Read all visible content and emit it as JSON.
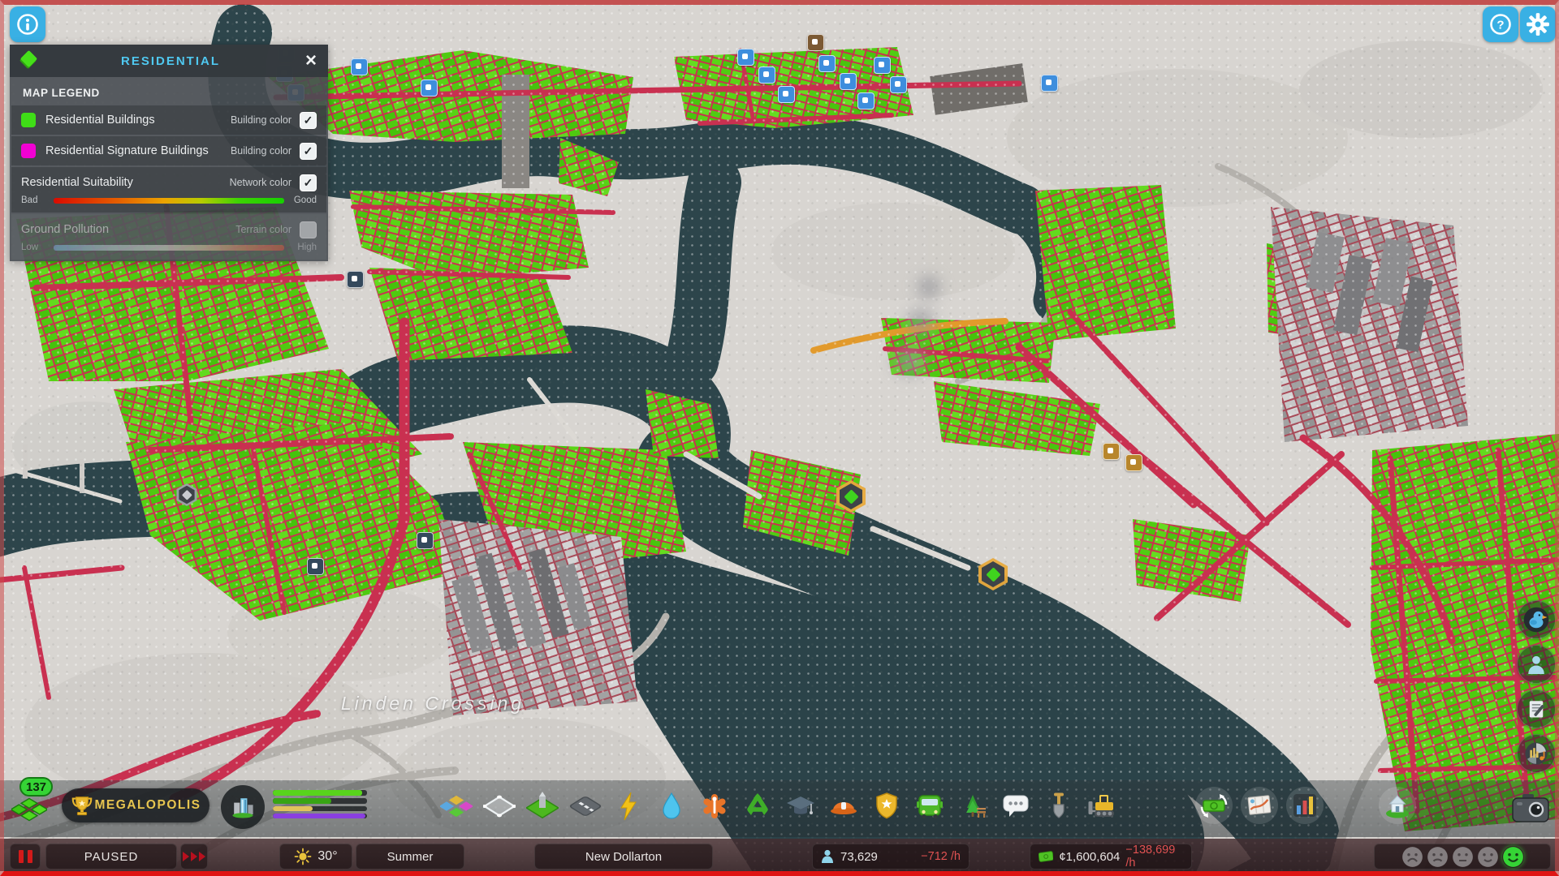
{
  "icons": {
    "info_glyph": "i",
    "help_glyph": "?",
    "close_glyph": "×",
    "check_glyph": "✓",
    "toolbar": [
      "zones",
      "areas",
      "landmarks",
      "roads",
      "electricity",
      "water-sewage",
      "healthcare",
      "garbage",
      "education",
      "fire-rescue",
      "police",
      "transportation",
      "parks-recreation",
      "communications",
      "terraforming",
      "bulldozer",
      "economy",
      "city-information",
      "statistics",
      "progression",
      "photo-mode"
    ],
    "side_panel": [
      "chirper",
      "citizens",
      "journal",
      "radio"
    ]
  },
  "legend_panel": {
    "title": "RESIDENTIAL",
    "section_title": "MAP LEGEND",
    "rows": [
      {
        "label": "Residential Buildings",
        "type_label": "Building color",
        "checked": true,
        "swatch_color": "#3fdd17"
      },
      {
        "label": "Residential Signature Buildings",
        "type_label": "Building color",
        "checked": true,
        "swatch_color": "#f101d3"
      },
      {
        "label": "Residential Suitability",
        "type_label": "Network color",
        "checked": true,
        "scale_min": "Bad",
        "scale_max": "Good"
      },
      {
        "label": "Ground Pollution",
        "type_label": "Terrain color",
        "checked": false,
        "disabled": true,
        "scale_min": "Low",
        "scale_max": "High"
      }
    ]
  },
  "map": {
    "district_label": "Linden Crossing"
  },
  "toolbar": {
    "level": "137",
    "milestone_name": "MEGALOPOLIS",
    "progress_bars": [
      {
        "pct": 95
      },
      {
        "pct": 62
      },
      {
        "pct": 42
      },
      {
        "pct": 98
      }
    ]
  },
  "status_bar": {
    "simulation_state": "PAUSED",
    "temperature": "30°",
    "season": "Summer",
    "city_name": "New Dollarton",
    "population": "73,629",
    "population_rate": "−712 /h",
    "money": "¢1,600,604",
    "money_rate": "−138,699 /h",
    "happiness_selected": "happy",
    "happiness_levels": [
      "very-unhappy",
      "unhappy",
      "neutral",
      "content",
      "happy"
    ]
  },
  "colors": {
    "accent_blue": "#39b0e4",
    "residential_green": "#3fdd17",
    "signature_magenta": "#f101d3",
    "road_red": "#c93050",
    "suitability_good_green": "#17d000",
    "suitability_bad_red": "#da0b00",
    "negative_rate_red": "#e05252",
    "milestone_gold": "#e7c54f",
    "happiness_green": "#35d435",
    "water_teal": "#2d454b"
  }
}
